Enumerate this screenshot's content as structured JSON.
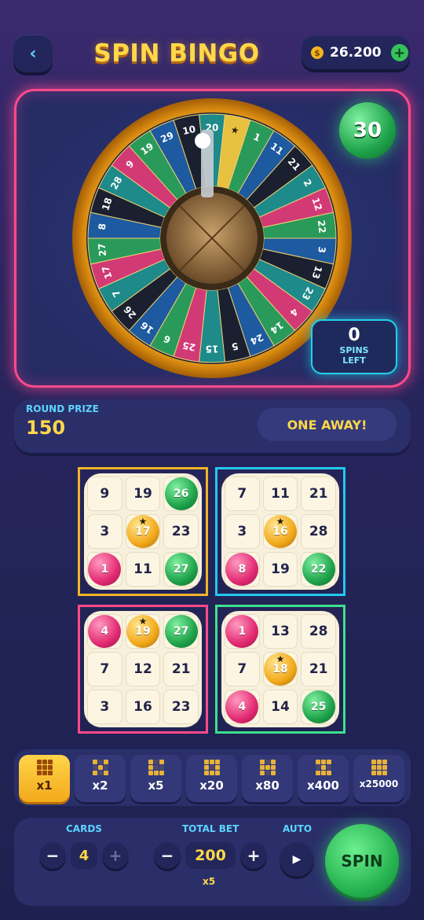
{
  "header": {
    "back_icon": "chevron-left-icon",
    "title": "SPIN BINGO",
    "balance": "26.200",
    "coin_symbol": "$"
  },
  "wheel": {
    "current_ball": "30",
    "spins_left_value": "0",
    "spins_left_label_1": "SPINS",
    "spins_left_label_2": "LEFT",
    "segments": [
      "20",
      "★",
      "1",
      "11",
      "21",
      "2",
      "12",
      "22",
      "3",
      "13",
      "23",
      "4",
      "14",
      "24",
      "5",
      "15",
      "25",
      "6",
      "16",
      "26",
      "7",
      "17",
      "27",
      "8",
      "18",
      "28",
      "9",
      "19",
      "29",
      "10"
    ]
  },
  "round": {
    "prize_label": "ROUND PRIZE",
    "prize_value": "150",
    "status": "ONE AWAY!"
  },
  "cards": [
    {
      "border": "#f0b428",
      "cells": [
        {
          "n": "9"
        },
        {
          "n": "19"
        },
        {
          "n": "26",
          "ball": "green"
        },
        {
          "n": "3"
        },
        {
          "n": "17",
          "ball": "gold",
          "star": true
        },
        {
          "n": "23"
        },
        {
          "n": "1",
          "ball": "pink"
        },
        {
          "n": "11"
        },
        {
          "n": "27",
          "ball": "green"
        }
      ]
    },
    {
      "border": "#22c8f0",
      "cells": [
        {
          "n": "7"
        },
        {
          "n": "11"
        },
        {
          "n": "21"
        },
        {
          "n": "3"
        },
        {
          "n": "16",
          "ball": "gold",
          "star": true
        },
        {
          "n": "28"
        },
        {
          "n": "8",
          "ball": "pink"
        },
        {
          "n": "19"
        },
        {
          "n": "22",
          "ball": "green"
        }
      ]
    },
    {
      "border": "#ff4a8a",
      "cells": [
        {
          "n": "4",
          "ball": "pink"
        },
        {
          "n": "19",
          "ball": "gold",
          "star": true
        },
        {
          "n": "27",
          "ball": "green"
        },
        {
          "n": "7"
        },
        {
          "n": "12"
        },
        {
          "n": "21"
        },
        {
          "n": "3"
        },
        {
          "n": "16"
        },
        {
          "n": "23"
        }
      ]
    },
    {
      "border": "#3ee08a",
      "cells": [
        {
          "n": "1",
          "ball": "pink"
        },
        {
          "n": "13"
        },
        {
          "n": "28"
        },
        {
          "n": "7"
        },
        {
          "n": "18",
          "ball": "gold",
          "star": true
        },
        {
          "n": "21"
        },
        {
          "n": "4",
          "ball": "pink"
        },
        {
          "n": "14"
        },
        {
          "n": "25",
          "ball": "green"
        }
      ]
    }
  ],
  "multipliers": [
    "x1",
    "x2",
    "x5",
    "x20",
    "x80",
    "x400",
    "x25000"
  ],
  "controls": {
    "cards_label": "CARDS",
    "cards_value": "4",
    "total_bet_label": "TOTAL BET",
    "total_bet_value": "200",
    "bet_multiplier": "x5",
    "auto_label": "AUTO",
    "spin_label": "SPIN",
    "minus_symbol": "−",
    "plus_symbol": "+",
    "play_symbol": "▶"
  },
  "colors": {
    "accent_gold": "#ffd84a",
    "accent_cyan": "#5fd3ff",
    "ball_green": "#1ea24a",
    "ball_pink": "#e22a72",
    "panel_border_pink": "#ff4a8a"
  }
}
